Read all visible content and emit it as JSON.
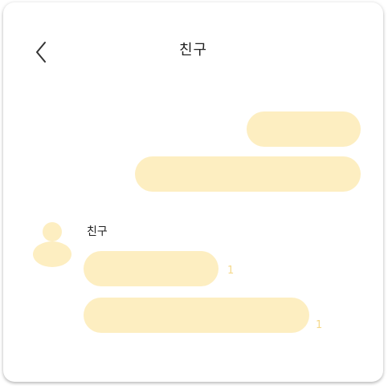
{
  "colors": {
    "bubble": "#FDEEC1",
    "avatar": "#FDEEC1",
    "unread": "#F5D98C",
    "icon": "#333333"
  },
  "header": {
    "title": "친구",
    "back_icon": "chevron-left-icon"
  },
  "messages": {
    "sender_name": "친구",
    "received": [
      {
        "unread_count": "1"
      },
      {
        "unread_count": "1"
      }
    ]
  }
}
